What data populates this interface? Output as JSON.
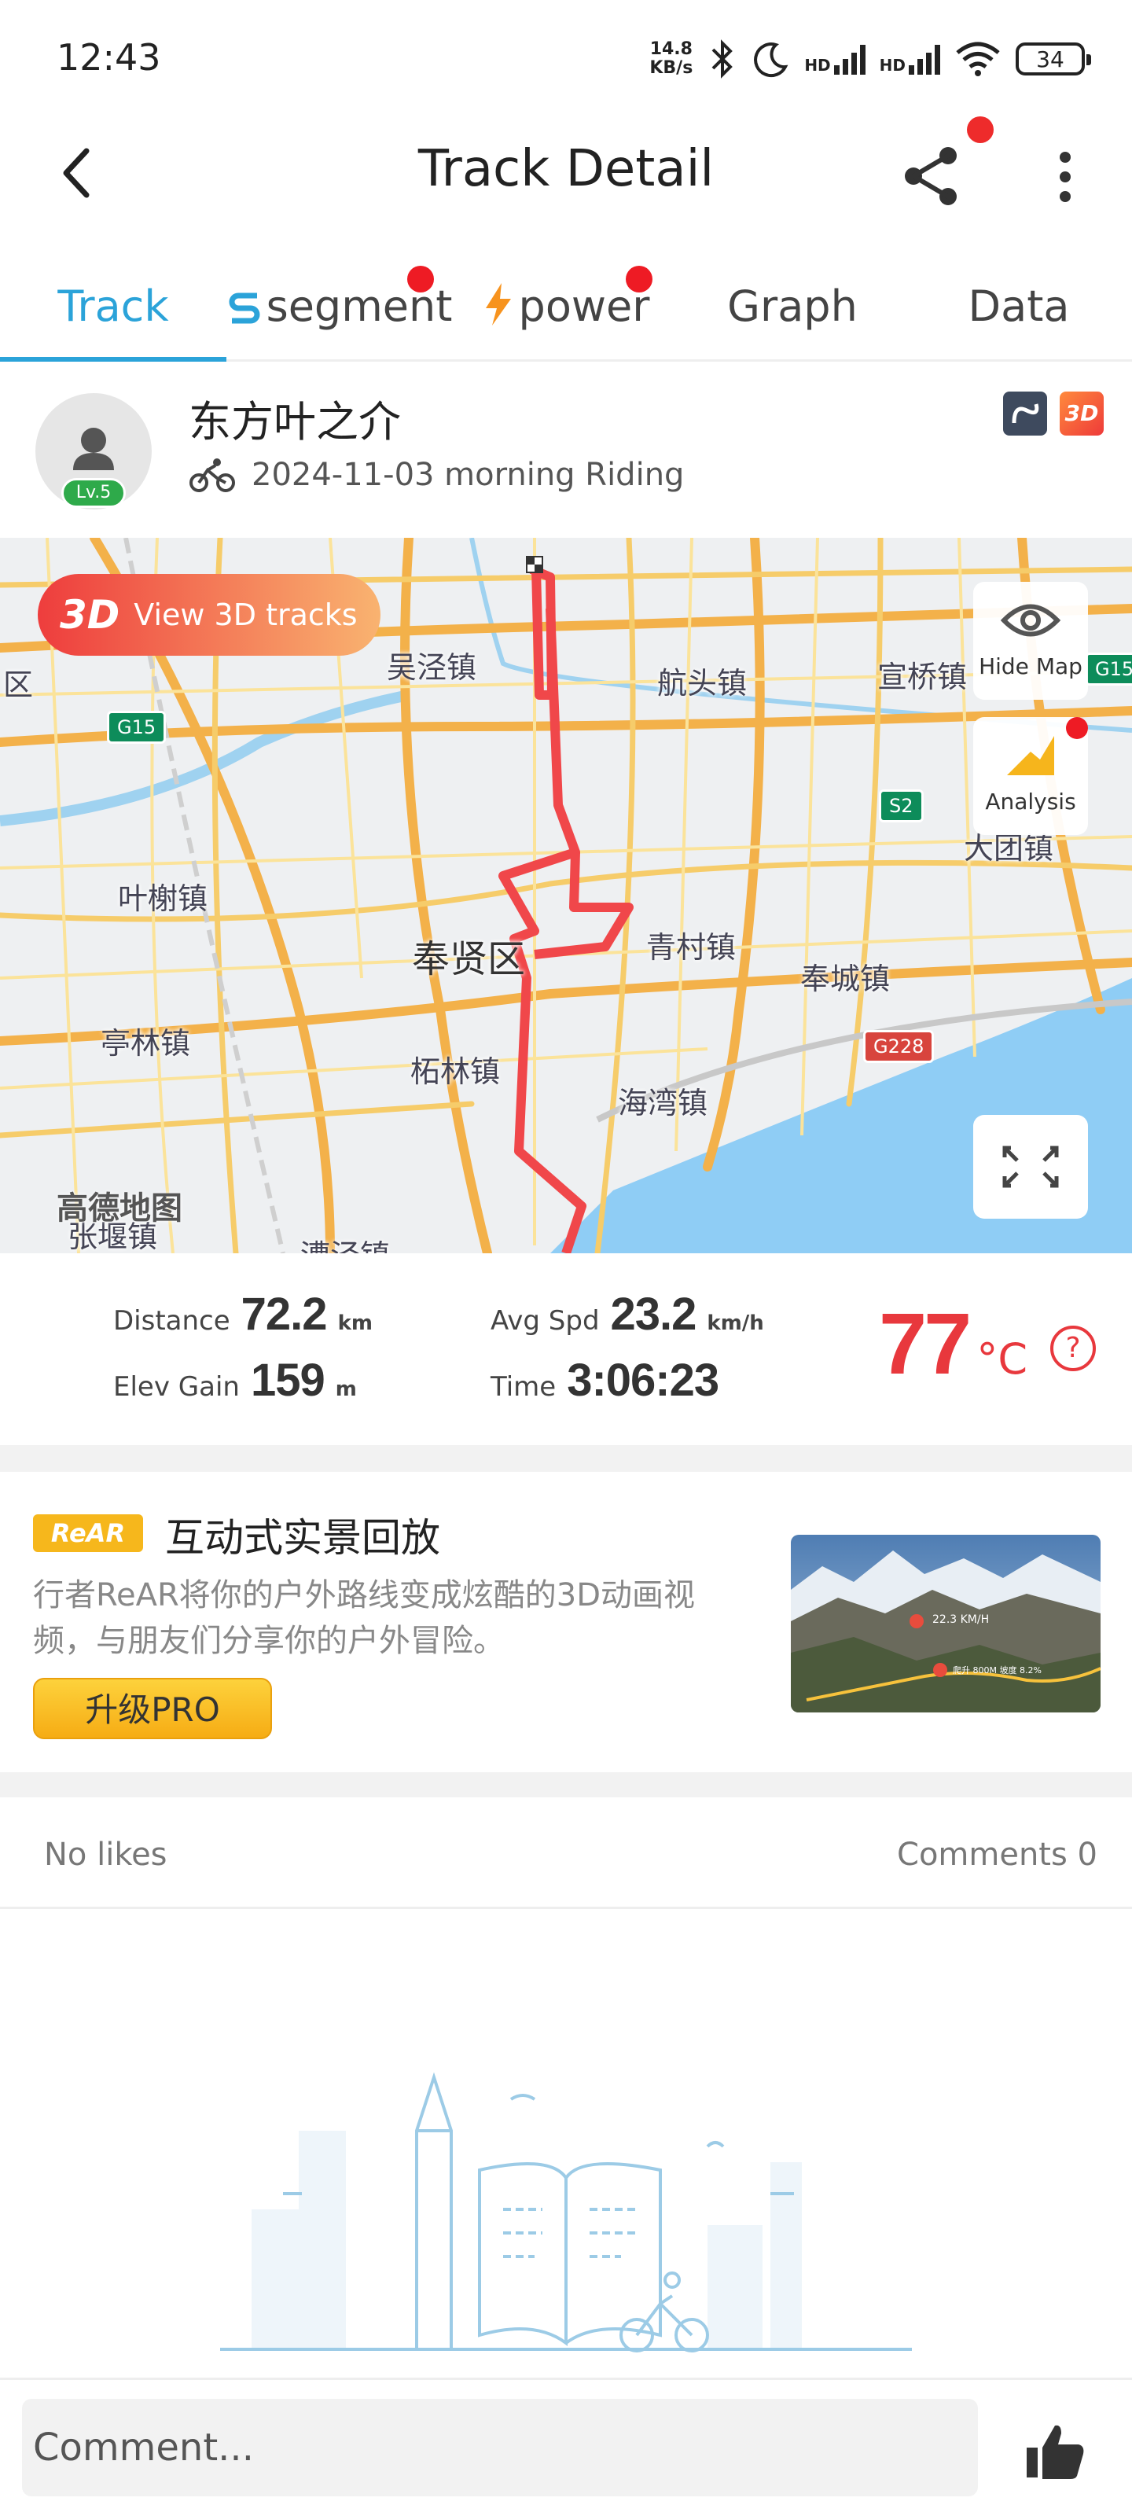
{
  "status_bar": {
    "time": "12:43",
    "net_speed_value": "14.8",
    "net_speed_unit": "KB/s",
    "signal1_label": "HD",
    "signal2_label": "HD",
    "battery": "34"
  },
  "header": {
    "title": "Track Detail"
  },
  "tabs": [
    {
      "label": "Track",
      "active": true
    },
    {
      "label": "segment",
      "icon": "segment-icon"
    },
    {
      "label": "power",
      "icon": "lightning-icon"
    },
    {
      "label": "Graph"
    },
    {
      "label": "Data"
    }
  ],
  "profile": {
    "name": "东方叶之介",
    "level": "Lv.5",
    "ride_info": "2024-11-03 morning Riding",
    "badge_3d": "3D"
  },
  "map": {
    "view_3d_badge": "3D",
    "view_3d_label": "View 3D tracks",
    "hide_map_label": "Hide Map",
    "analysis_label": "Analysis",
    "logo": "高德地图",
    "labels": {
      "wujing": "吴泾镇",
      "hangtou": "航头镇",
      "xuanqiao": "宣桥镇",
      "qu": "区",
      "yeshu": "叶榭镇",
      "fengxian": "奉贤区",
      "qingcun": "青村镇",
      "fengcheng": "奉城镇",
      "datuan": "大团镇",
      "tinglin": "亭林镇",
      "zhelin": "柘林镇",
      "haiwan": "海湾镇",
      "zhangyan": "张堰镇",
      "caojing": "漕泾镇"
    },
    "highways": {
      "g15_left": "G15",
      "g15_right": "G15",
      "s2": "S2",
      "g228": "G228"
    }
  },
  "stats": {
    "distance_label": "Distance",
    "distance_value": "72.2",
    "distance_unit": "km",
    "avg_spd_label": "Avg Spd",
    "avg_spd_value": "23.2",
    "avg_spd_unit": "km/h",
    "elev_gain_label": "Elev Gain",
    "elev_gain_value": "159",
    "elev_gain_unit": "m",
    "time_label": "Time",
    "time_value": "3:06:23",
    "temperature_value": "77",
    "temperature_unit": "°C",
    "help": "?"
  },
  "promo": {
    "logo": "ReAR",
    "title": "互动式实景回放",
    "description": "行者ReAR将你的户外路线变成炫酷的3D动画视频，与朋友们分享你的户外冒险。",
    "button": "升级PRO",
    "preview_speed": "22.3 KM/H",
    "preview_stat": "爬升 800M 坡度 8.2%"
  },
  "social": {
    "likes": "No likes",
    "comments": "Comments 0"
  },
  "comment_bar": {
    "placeholder": "Comment..."
  },
  "colors": {
    "accent": "#2ba3d9",
    "route": "#f0474a",
    "temperature": "#e8383d",
    "level_badge": "#2eaa4a",
    "notification_dot": "#ee1b24"
  }
}
